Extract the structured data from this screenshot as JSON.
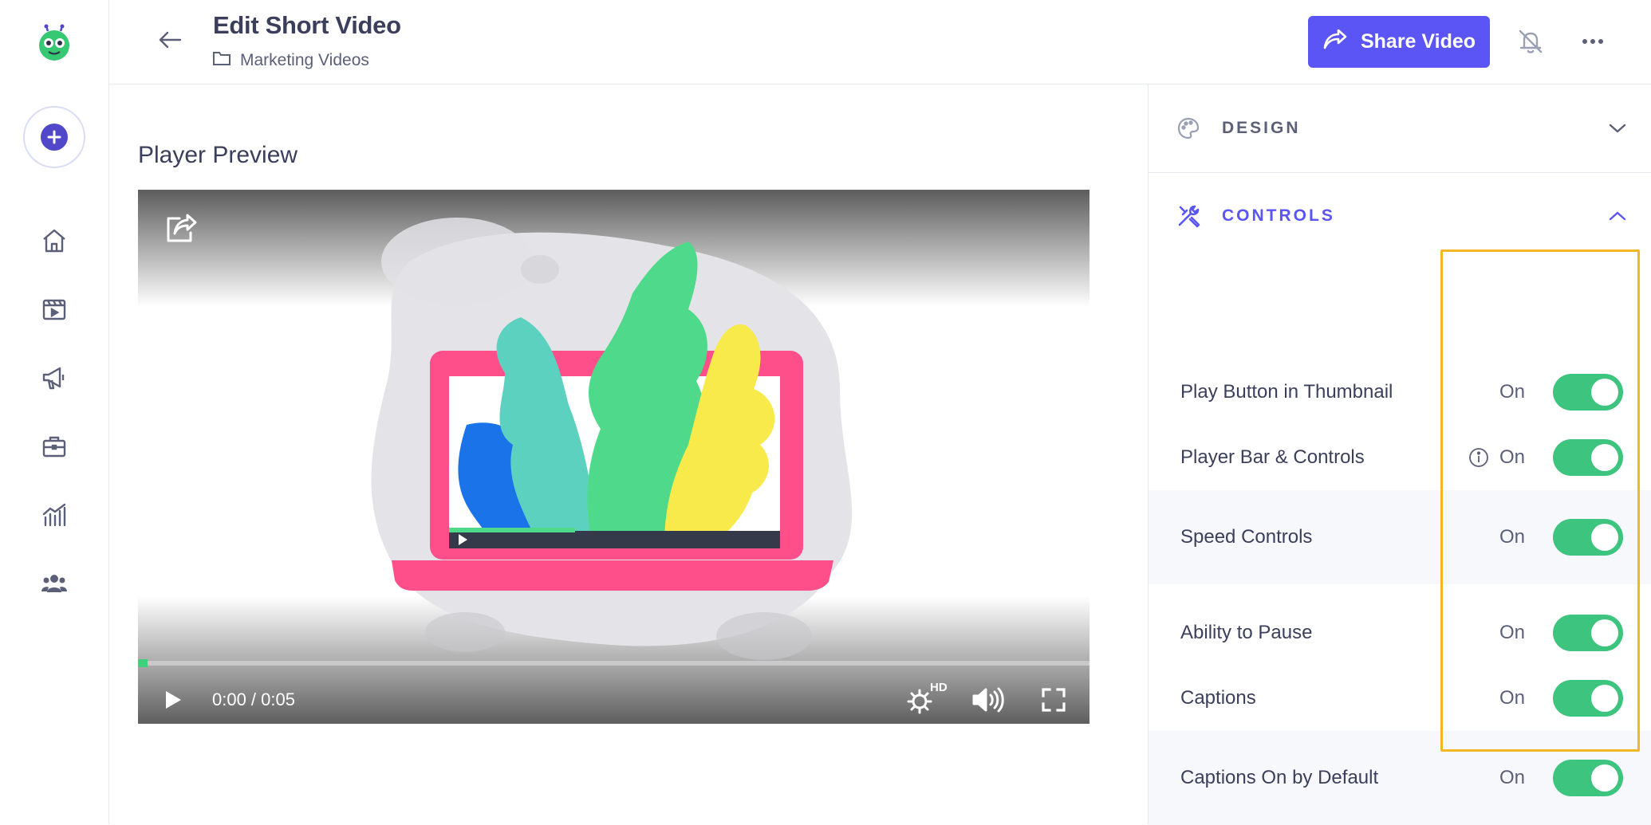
{
  "header": {
    "title": "Edit Short Video",
    "folder": "Marketing Videos",
    "share_label": "Share Video"
  },
  "main": {
    "heading": "Player Preview",
    "player": {
      "time": "0:00 / 0:05",
      "quality_badge": "HD",
      "progress_fraction": 0.01
    }
  },
  "panel": {
    "design_label": "DESIGN",
    "controls_label": "CONTROLS",
    "rows": [
      {
        "label": "Play Button in Thumbnail",
        "state": "On"
      },
      {
        "label": "Player Bar & Controls",
        "state": "On"
      },
      {
        "label": "Speed Controls",
        "state": "On"
      },
      {
        "label": "Ability to Pause",
        "state": "On"
      },
      {
        "label": "Captions",
        "state": "On"
      },
      {
        "label": "Captions On by Default",
        "state": "On"
      }
    ]
  },
  "icons": {
    "nav": [
      "home-icon",
      "videos-icon",
      "campaigns-icon",
      "business-icon",
      "analytics-icon",
      "team-icon"
    ]
  },
  "colors": {
    "accent": "#5b55f5",
    "toggle_on": "#3dc47e",
    "highlight": "#f2b824",
    "brand": "#5147c9"
  }
}
